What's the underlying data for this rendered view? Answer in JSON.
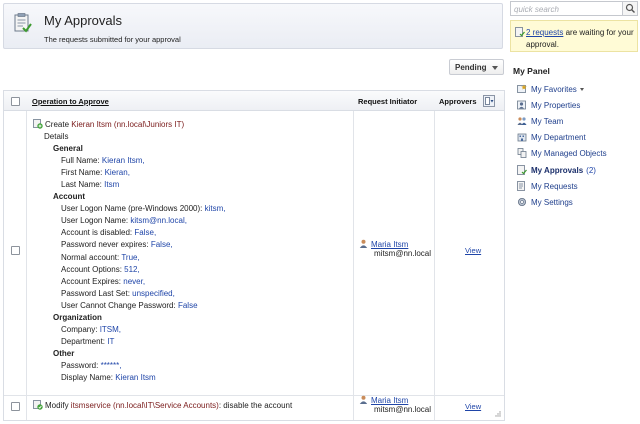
{
  "header": {
    "title": "My Approvals",
    "subtitle": "The requests submitted for your approval"
  },
  "filter": {
    "selected": "Pending"
  },
  "grid": {
    "columns": {
      "operation": "Operation to Approve",
      "initiator": "Request Initiator",
      "approvers": "Approvers"
    },
    "rows": [
      {
        "op_prefix": "Create ",
        "op_target": "Kieran Itsm (nn.local\\Juniors IT)",
        "details_label": "Details",
        "sections": [
          {
            "title": "General",
            "fields": [
              {
                "label": "Full Name: ",
                "value": "Kieran Itsm",
                "suffix": ","
              },
              {
                "label": "First Name: ",
                "value": "Kieran",
                "suffix": ","
              },
              {
                "label": "Last Name: ",
                "value": "Itsm",
                "suffix": ""
              }
            ]
          },
          {
            "title": "Account",
            "fields": [
              {
                "label": "User Logon Name (pre-Windows 2000): ",
                "value": "kitsm",
                "suffix": ","
              },
              {
                "label": "User Logon Name: ",
                "value": "kitsm@nn.local",
                "suffix": ","
              },
              {
                "label": "Account is disabled: ",
                "value": "False",
                "suffix": ","
              },
              {
                "label": "Password never expires: ",
                "value": "False",
                "suffix": ","
              },
              {
                "label": "Normal account: ",
                "value": "True",
                "suffix": ","
              },
              {
                "label": "Account Options: ",
                "value": "512",
                "suffix": ","
              },
              {
                "label": "Account Expires: ",
                "value": "never",
                "suffix": ","
              },
              {
                "label": "Password Last Set: ",
                "value": "unspecified",
                "suffix": ","
              },
              {
                "label": "User Cannot Change Password: ",
                "value": "False",
                "suffix": ""
              }
            ]
          },
          {
            "title": "Organization",
            "fields": [
              {
                "label": "Company: ",
                "value": "ITSM",
                "suffix": ","
              },
              {
                "label": "Department: ",
                "value": "IT",
                "suffix": ""
              }
            ]
          },
          {
            "title": "Other",
            "fields": [
              {
                "label": "Password: ",
                "value": "******",
                "suffix": ","
              },
              {
                "label": "Display Name: ",
                "value": "Kieran Itsm",
                "suffix": ""
              }
            ]
          }
        ],
        "initiator_name": "Maria Itsm",
        "initiator_email": "mitsm@nn.local",
        "view_label": "View"
      },
      {
        "op_prefix": "Modify ",
        "op_target": "itsmservice (nn.local\\IT\\Service Accounts)",
        "op_suffix": ": disable the account",
        "initiator_name": "Maria Itsm",
        "initiator_email": "mitsm@nn.local",
        "view_label": "View"
      }
    ]
  },
  "search": {
    "placeholder": "quick search"
  },
  "notice": {
    "link": "2 requests",
    "text": " are waiting for your approval."
  },
  "panel": {
    "title": "My Panel",
    "items": [
      {
        "label": "My Favorites",
        "icon": "favorites-icon"
      },
      {
        "label": "My Properties",
        "icon": "properties-icon"
      },
      {
        "label": "My Team",
        "icon": "team-icon"
      },
      {
        "label": "My Department",
        "icon": "department-icon"
      },
      {
        "label": "My Managed Objects",
        "icon": "managed-objects-icon"
      },
      {
        "label": "My Approvals",
        "icon": "approvals-icon",
        "count": "(2)"
      },
      {
        "label": "My Requests",
        "icon": "requests-icon"
      },
      {
        "label": "My Settings",
        "icon": "settings-icon"
      }
    ]
  }
}
